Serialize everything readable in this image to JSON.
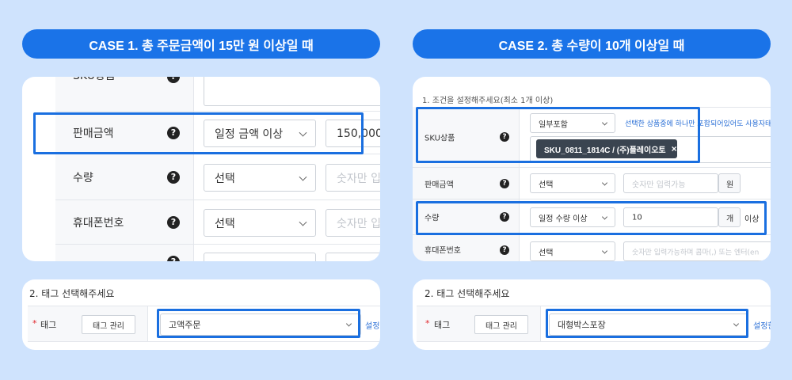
{
  "case1": {
    "title": "CASE 1. 총 주문금액이 15만 원 이상일 때",
    "rows": {
      "sku": {
        "label": "SKU상품"
      },
      "amount": {
        "label": "판매금액",
        "condition": "일정 금액 이상",
        "value": "150,000"
      },
      "quantity": {
        "label": "수량",
        "condition": "선택",
        "placeholder": "숫자만 입력가능"
      },
      "phone": {
        "label": "휴대폰번호",
        "condition": "선택",
        "placeholder": "숫자만 입력가능"
      }
    },
    "help_icon": "?",
    "tags": {
      "heading": "2. 태그 선택해주세요",
      "required_mark": "*",
      "label": "태그",
      "manage_button": "태그 관리",
      "selected": "고액주문",
      "link": "설정한"
    }
  },
  "case2": {
    "title": "CASE 2. 총 수량이 10개 이상일 때",
    "section_heading": "1. 조건을 설정해주세요(최소 1개 이상)",
    "rows": {
      "sku": {
        "label": "SKU상품",
        "condition": "일부포함",
        "hint": "선택한 상품중에 하나만 포함되어있어도 사용자태",
        "chip": "SKU_0811_1814C / (주)플레이오토",
        "chip_remove": "×"
      },
      "amount": {
        "label": "판매금액",
        "condition": "선택",
        "placeholder": "숫자만 입력가능",
        "unit": "원"
      },
      "quantity": {
        "label": "수량",
        "condition": "일정 수량 이상",
        "value": "10",
        "unit": "개",
        "suffix": "이상"
      },
      "phone": {
        "label": "휴대폰번호",
        "condition": "선택",
        "placeholder": "숫자만 입력가능하며 콤마(,) 또는 엔터(en"
      }
    },
    "help_icon": "?",
    "tags": {
      "heading": "2. 태그 선택해주세요",
      "required_mark": "*",
      "label": "태그",
      "manage_button": "태그 관리",
      "selected": "대형박스포장",
      "link": "설정한"
    }
  },
  "colors": {
    "background": "#cfe3fd",
    "accent": "#1a73e8",
    "required": "#e0262b"
  }
}
